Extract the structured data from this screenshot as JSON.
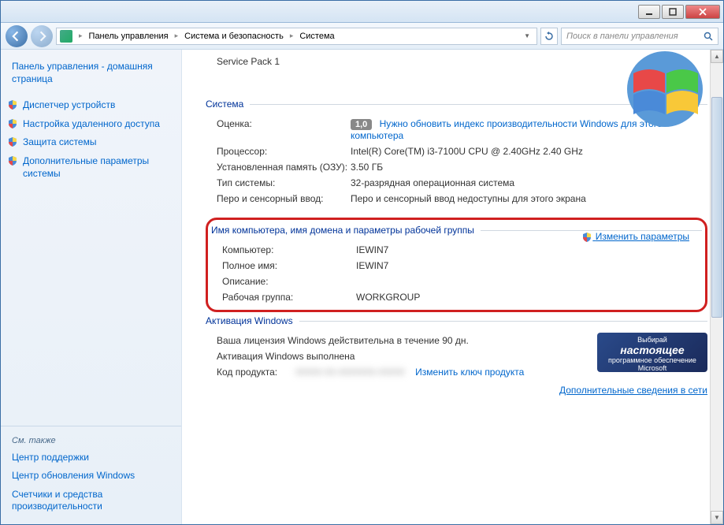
{
  "breadcrumb": {
    "root": "Панель управления",
    "cat": "Система и безопасность",
    "page": "Система"
  },
  "search": {
    "placeholder": "Поиск в панели управления"
  },
  "sidebar": {
    "home": "Панель управления - домашняя страница",
    "links": [
      "Диспетчер устройств",
      "Настройка удаленного доступа",
      "Защита системы",
      "Дополнительные параметры системы"
    ],
    "see_also_hdr": "См. также",
    "see_also": [
      "Центр поддержки",
      "Центр обновления Windows",
      "Счетчики и средства производительности"
    ]
  },
  "main": {
    "service_pack": "Service Pack 1",
    "system_hdr": "Система",
    "rating_label": "Оценка:",
    "rating_value": "1,0",
    "rating_link": "Нужно обновить индекс производительности Windows для этого компьютера",
    "cpu_label": "Процессор:",
    "cpu_value": "Intel(R) Core(TM) i3-7100U CPU @ 2.40GHz   2.40 GHz",
    "ram_label": "Установленная память (ОЗУ):",
    "ram_value": "3.50 ГБ",
    "systype_label": "Тип системы:",
    "systype_value": "32-разрядная операционная система",
    "pen_label": "Перо и сенсорный ввод:",
    "pen_value": "Перо и сенсорный ввод недоступны для этого экрана",
    "name_hdr": "Имя компьютера, имя домена и параметры рабочей группы",
    "comp_label": "Компьютер:",
    "comp_value": "IEWIN7",
    "full_label": "Полное имя:",
    "full_value": "IEWIN7",
    "desc_label": "Описание:",
    "desc_value": "",
    "wg_label": "Рабочая группа:",
    "wg_value": "WORKGROUP",
    "change_link": "Изменить параметры",
    "act_hdr": "Активация Windows",
    "act_line1": "Ваша лицензия Windows действительна в течение 90 дн.",
    "act_line2": "Активация Windows выполнена",
    "product_label": "Код продукта:",
    "product_value": "00000-00-0000000-00000",
    "product_link": "Изменить ключ продукта",
    "banner_top": "Выбирай",
    "banner_mid": "настоящее",
    "banner_bot": "программное обеспечение Microsoft",
    "more_link": "Дополнительные сведения в сети"
  }
}
